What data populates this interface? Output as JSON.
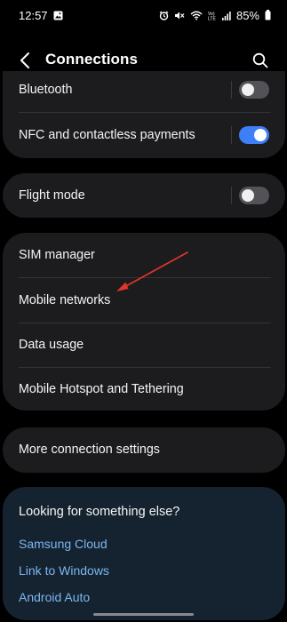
{
  "status_bar": {
    "time": "12:57",
    "battery": "85%",
    "left_icons": [
      "gallery-icon"
    ],
    "right_icons": [
      "alarm-icon",
      "mute-icon",
      "wifi-icon",
      "volte-icon",
      "signal-icon",
      "battery-icon"
    ]
  },
  "header": {
    "title": "Connections",
    "back_icon": "chevron-left-icon",
    "search_icon": "search-icon"
  },
  "card1": {
    "items": [
      {
        "label": "Bluetooth",
        "toggle": "off"
      },
      {
        "label": "NFC and contactless payments",
        "toggle": "on"
      }
    ]
  },
  "card2": {
    "items": [
      {
        "label": "Flight mode",
        "toggle": "off"
      }
    ]
  },
  "card3": {
    "items": [
      {
        "label": "SIM manager"
      },
      {
        "label": "Mobile networks"
      },
      {
        "label": "Data usage"
      },
      {
        "label": "Mobile Hotspot and Tethering"
      }
    ]
  },
  "card4": {
    "items": [
      {
        "label": "More connection settings"
      }
    ]
  },
  "looking_for": {
    "heading": "Looking for something else?",
    "links": [
      "Samsung Cloud",
      "Link to Windows",
      "Android Auto"
    ]
  },
  "colors": {
    "background": "#000000",
    "card": "#1c1c1e",
    "suggestion_card": "#14232f",
    "toggle_on": "#3e7ef7",
    "link": "#7eb6f2",
    "annotation_arrow": "#e0362b"
  }
}
